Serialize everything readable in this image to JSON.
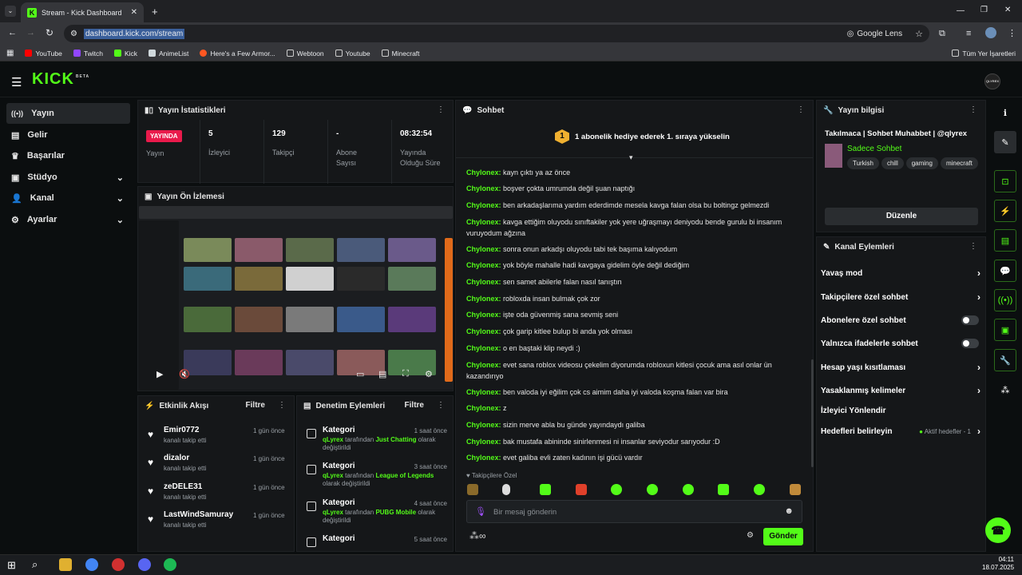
{
  "browser": {
    "tab_title": "Stream - Kick Dashboard",
    "url": "dashboard.kick.com/stream",
    "lens_label": "Google Lens",
    "bookmarks": [
      "YouTube",
      "Twitch",
      "Kick",
      "AnimeList",
      "Here's a Few Armor...",
      "Webtoon",
      "Youtube",
      "Minecraft"
    ],
    "bookmarks_all": "Tüm Yer İşaretleri"
  },
  "app": {
    "logo": "KICK",
    "logo_badge": "BETA",
    "avatar_label": "QLYREX"
  },
  "sidebar": {
    "items": [
      {
        "label": "Yayın",
        "icon": "broadcast-icon"
      },
      {
        "label": "Gelir",
        "icon": "revenue-icon"
      },
      {
        "label": "Başarılar",
        "icon": "trophy-icon"
      },
      {
        "label": "Stüdyo",
        "icon": "studio-icon"
      },
      {
        "label": "Kanal",
        "icon": "channel-icon"
      },
      {
        "label": "Ayarlar",
        "icon": "gear-icon"
      }
    ]
  },
  "stats": {
    "title": "Yayın İstatistikleri",
    "live_badge": "YAYINDA",
    "live_label": "Yayın",
    "viewers_value": "5",
    "viewers_label": "İzleyici",
    "followers_value": "129",
    "followers_label": "Takipçi",
    "subs_value": "-",
    "subs_label": "Abone Sayısı",
    "uptime_value": "08:32:54",
    "uptime_label": "Yayında Olduğu Süre"
  },
  "preview": {
    "title": "Yayın Ön İzlemesi"
  },
  "activity": {
    "title": "Etkinlik Akışı",
    "filter": "Filtre",
    "items": [
      {
        "name": "Emir0772",
        "desc": "kanalı takip etti",
        "time": "1 gün önce"
      },
      {
        "name": "dizalor",
        "desc": "kanalı takip etti",
        "time": "1 gün önce"
      },
      {
        "name": "zeDELE31",
        "desc": "kanalı takip etti",
        "time": "1 gün önce"
      },
      {
        "name": "LastWindSamuray",
        "desc": "kanalı takip etti",
        "time": "1 gün önce"
      }
    ]
  },
  "moderation": {
    "title": "Denetim Eylemleri",
    "filter": "Filtre",
    "items": [
      {
        "kind": "Kategori",
        "time": "1 saat önce",
        "user": "qLyrex",
        "mid": "tarafından",
        "cat": "Just Chatting",
        "end": "olarak değiştirildi"
      },
      {
        "kind": "Kategori",
        "time": "3 saat önce",
        "user": "qLyrex",
        "mid": "tarafından",
        "cat": "League of Legends",
        "end": "olarak değiştirildi"
      },
      {
        "kind": "Kategori",
        "time": "4 saat önce",
        "user": "qLyrex",
        "mid": "tarafından",
        "cat": "PUBG Mobile",
        "end": "olarak değiştirildi"
      },
      {
        "kind": "Kategori",
        "time": "5 saat önce",
        "user": "",
        "mid": "",
        "cat": "",
        "end": ""
      }
    ]
  },
  "chat": {
    "title": "Sohbet",
    "gift_badge": "1",
    "gift_text": "1 abonelik hediye ederek 1. sıraya yükselin",
    "messages": [
      {
        "user": "Chylonex:",
        "text": "kayn çıktı ya az önce"
      },
      {
        "user": "Chylonex:",
        "text": "boşver çokta umrumda değil şuan naptığı"
      },
      {
        "user": "Chylonex:",
        "text": "ben arkadaşlarıma yardım ederdimde mesela kavga falan olsa bu boltingz gelmezdi"
      },
      {
        "user": "Chylonex:",
        "text": "kavga ettiğim oluyodu sınıftakiler yok yere uğraşmayı deniyodu bende gurulu bi insanım vuruyodum ağzına"
      },
      {
        "user": "Chylonex:",
        "text": "sonra onun arkadşı oluyodu tabi tek başıma kalıyodum"
      },
      {
        "user": "Chylonex:",
        "text": "yok böyle mahalle hadi kavgaya gidelim öyle değil dediğim"
      },
      {
        "user": "Chylonex:",
        "text": "sen samet abilerle falan nasıl tanıştın"
      },
      {
        "user": "Chylonex:",
        "text": "robloxda insan bulmak çok zor"
      },
      {
        "user": "Chylonex:",
        "text": "işte oda güvenmiş sana sevmiş seni"
      },
      {
        "user": "Chylonex:",
        "text": "çok garip kitlee bulup bi anda yok olması"
      },
      {
        "user": "Chylonex:",
        "text": "o en baştaki klip neydi :)"
      },
      {
        "user": "Chylonex:",
        "text": "evet sana roblox videosu çekelim diyorumda robloxun kitlesi çocuk ama asıl onlar ün kazandırıyo"
      },
      {
        "user": "Chylonex:",
        "text": "ben valoda iyi eğilim çok cs aimim daha iyi valoda koşma falan var bira"
      },
      {
        "user": "Chylonex:",
        "text": "z"
      },
      {
        "user": "Chylonex:",
        "text": "sizin merve abla bu günde yayındaydı galiba"
      },
      {
        "user": "Chylonex:",
        "text": "bak mustafa abininde sinirlenmesi ni insanlar seviyodur sarıyodur :D"
      },
      {
        "user": "Chylonex:",
        "text": "evet galiba evli zaten kadının işi gücü vardır"
      }
    ],
    "follower_emotes_label": "Takipçilere Özel",
    "input_placeholder": "Bir mesaj gönderin",
    "send": "Gönder"
  },
  "stream_info": {
    "title": "Yayın bilgisi",
    "stream_title": "Takılmaca | Sohbet Muhabbet | @qlyrex",
    "category": "Sadece Sohbet",
    "tags": [
      "Turkish",
      "chill",
      "gaming",
      "minecraft"
    ],
    "edit": "Düzenle"
  },
  "channel_actions": {
    "title": "Kanal Eylemleri",
    "items": [
      {
        "label": "Yavaş mod",
        "control": "chevron"
      },
      {
        "label": "Takipçilere özel sohbet",
        "control": "chevron"
      },
      {
        "label": "Abonelere özel sohbet",
        "control": "toggle"
      },
      {
        "label": "Yalnızca ifadelerle sohbet",
        "control": "toggle"
      },
      {
        "label": "Hesap yaşı kısıtlaması",
        "control": "chevron"
      },
      {
        "label": "Yasaklanmış kelimeler",
        "control": "chevron"
      },
      {
        "label": "İzleyici Yönlendir",
        "control": "none"
      },
      {
        "label": "Hedefleri belirleyin",
        "control": "chevron"
      }
    ],
    "goals_status": "Aktif hedefler - 1"
  },
  "taskbar": {
    "time": "04:11",
    "date": "18.07.2025"
  },
  "colors": {
    "accent": "#53fc18",
    "live": "#e91a4b",
    "bg": "#0b0e0f",
    "panel": "#151719"
  }
}
